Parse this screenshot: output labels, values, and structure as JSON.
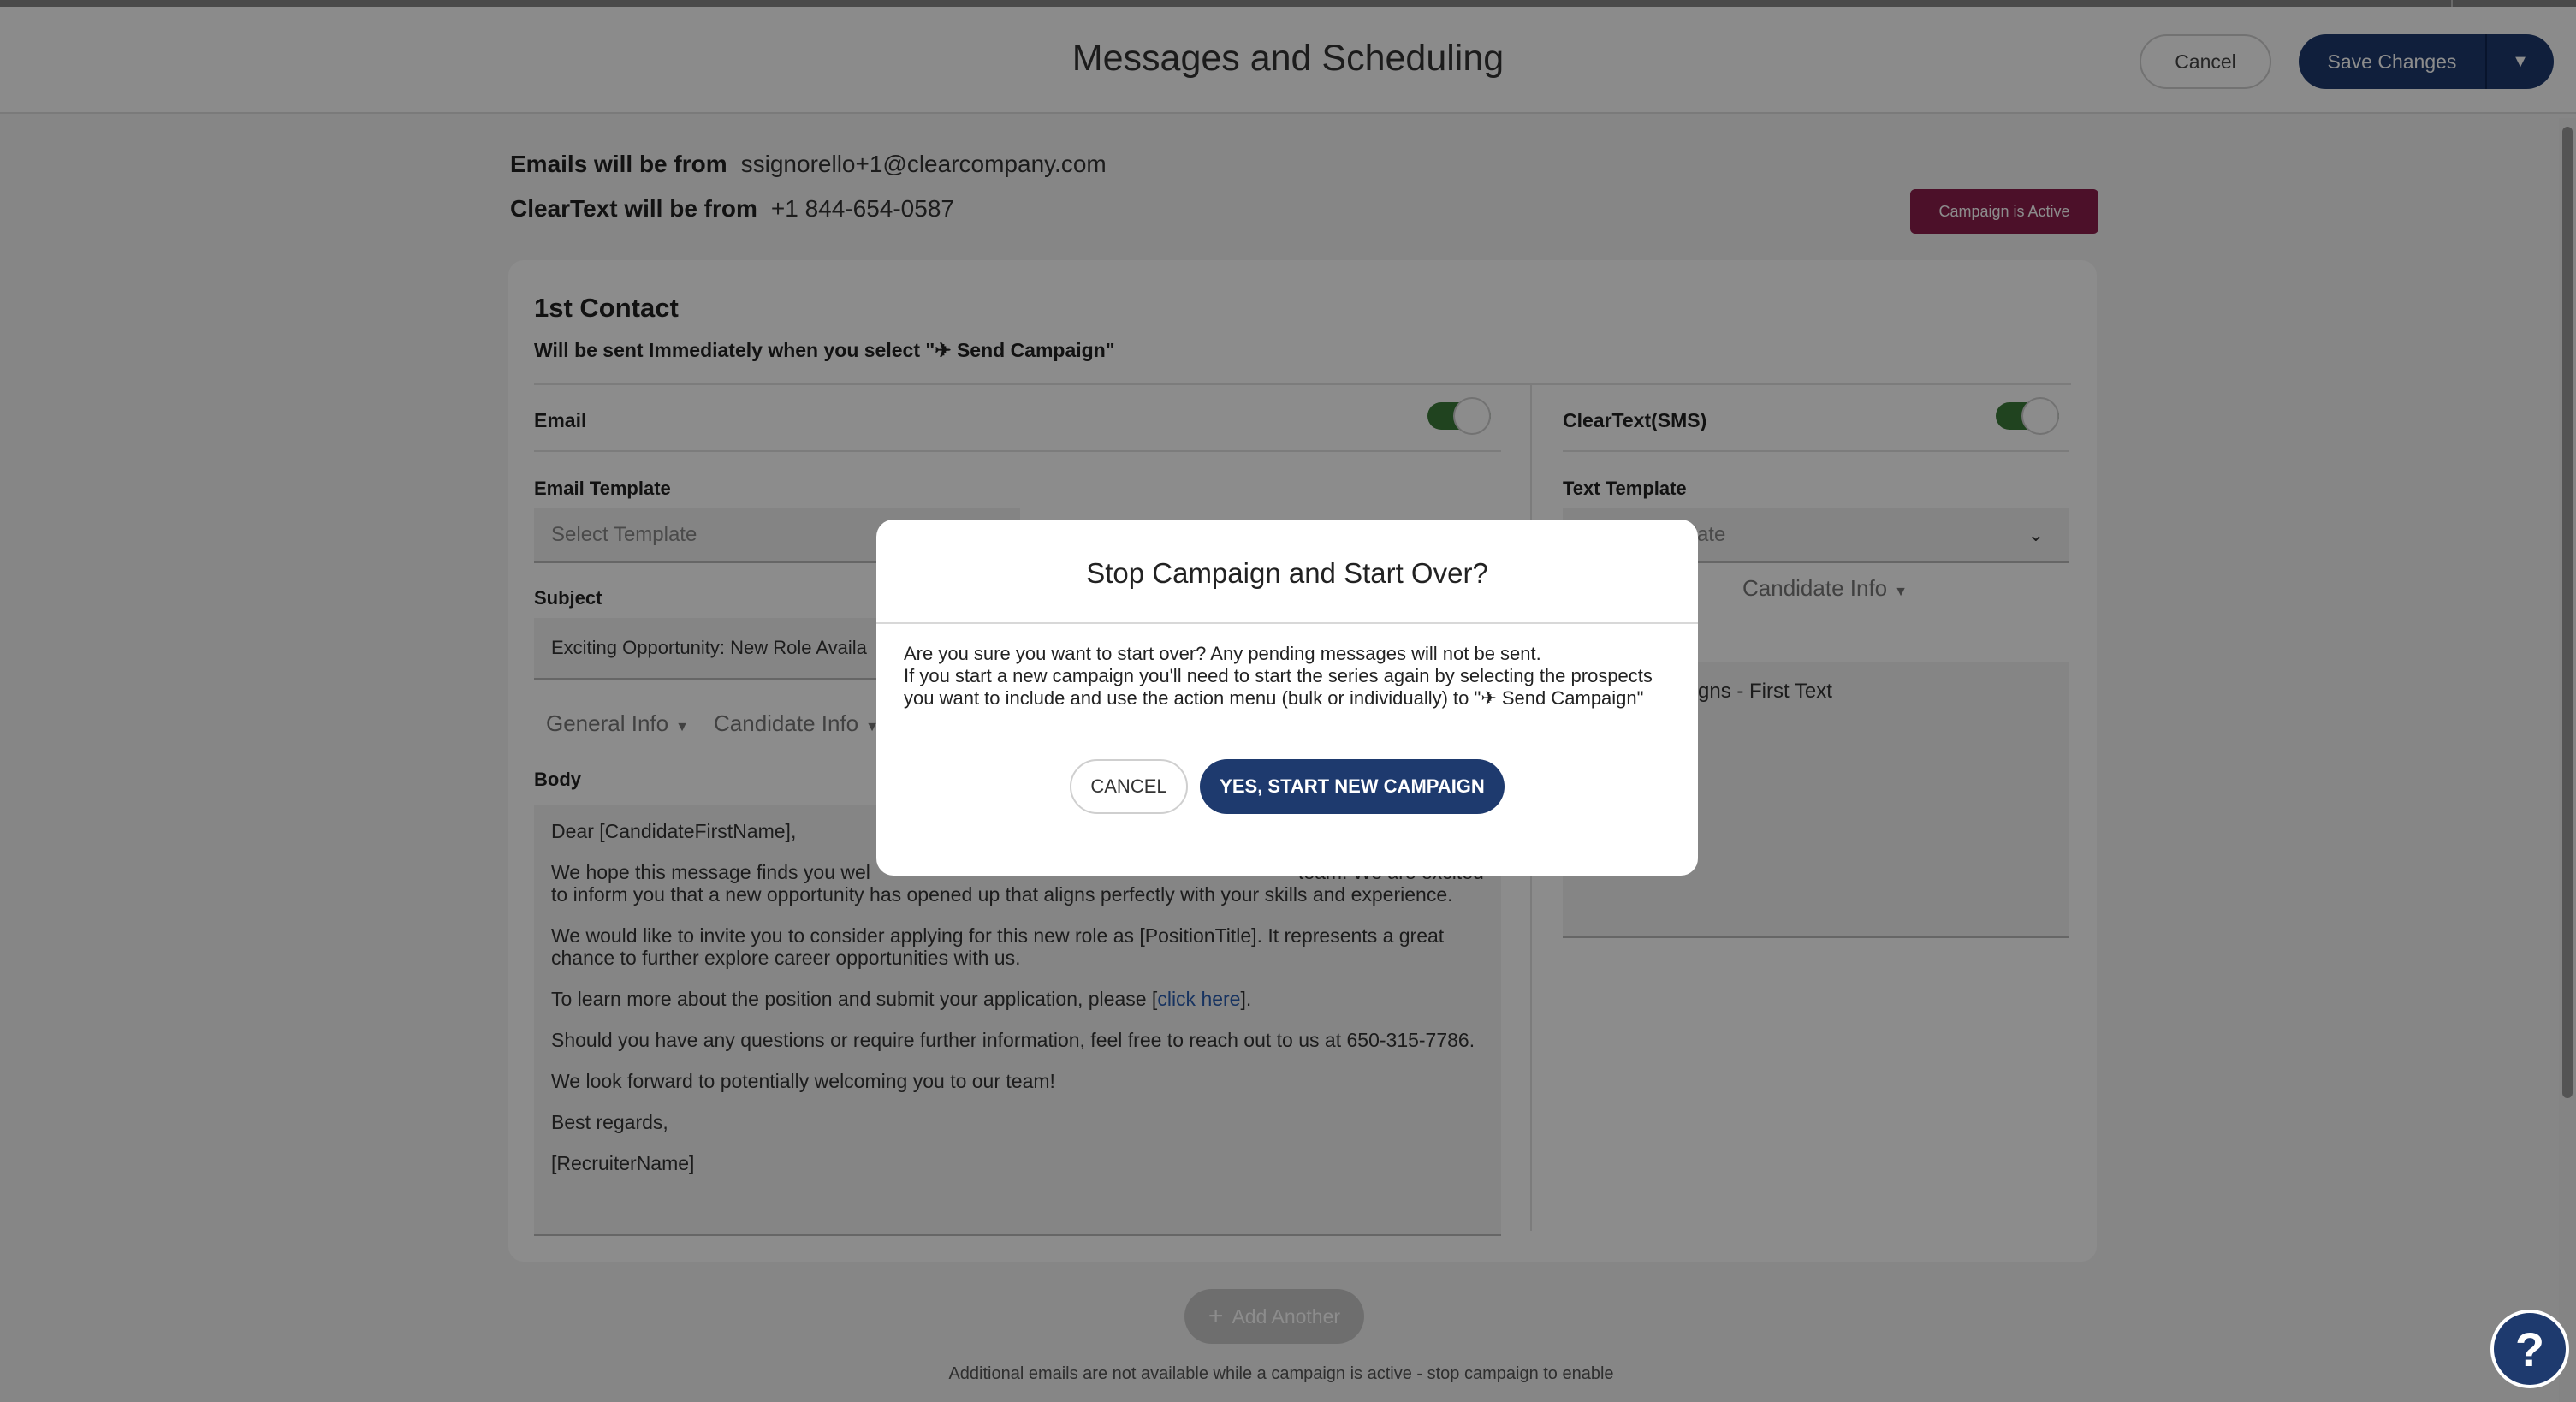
{
  "header": {
    "title": "Messages and Scheduling",
    "cancel_label": "Cancel",
    "save_label": "Save Changes"
  },
  "from": {
    "email_label": "Emails will be from",
    "email_value": "ssignorello+1@clearcompany.com",
    "text_label": "ClearText will be from",
    "text_value": "+1 844-654-0587"
  },
  "campaign_status": "Campaign is Active",
  "contact": {
    "title": "1st Contact",
    "schedule_prefix": "Will be sent Immediately when you select \"",
    "schedule_action": "Send Campaign",
    "schedule_suffix": "\"",
    "email": {
      "label": "Email",
      "enabled": true,
      "template_label": "Email Template",
      "template_placeholder": "Select Template",
      "subject_label": "Subject",
      "subject_value": "Exciting Opportunity: New Role Availa",
      "menu_general": "General Info",
      "menu_candidate": "Candidate Info",
      "body_label": "Body",
      "body": {
        "p1": "Dear [CandidateFirstName],",
        "p2": "We hope this message finds you wel",
        "p2b": "team. We are excited to inform you that a new opportunity has opened up that aligns perfectly with your skills and experience.",
        "p3": "We would like to invite you to consider applying for this new role as [PositionTitle]. It represents a great chance to further explore career opportunities with us.",
        "p4_prefix": "To learn more about the position and submit your application, please [",
        "p4_link": "click here",
        "p4_suffix": "].",
        "p5": "Should you have any questions or require further information, feel free to reach out to us at 650-315-7786.",
        "p6": "We look forward to potentially welcoming you to our team!",
        "p7": "Best regards,",
        "p8": "[RecruiterName]"
      }
    },
    "sms": {
      "label": "ClearText(SMS)",
      "enabled": true,
      "template_label": "Text Template",
      "template_placeholder": "Select Template",
      "menu_candidate": "Candidate Info",
      "text_value": "gns - First Text"
    }
  },
  "add_another_label": "Add Another",
  "footer_note": "Additional emails are not available while a campaign is active - stop campaign to enable",
  "modal": {
    "title": "Stop Campaign and Start Over?",
    "line1": "Are you sure you want to start over? Any pending messages will not be sent.",
    "line2_prefix": "If you start a new campaign you'll need to start the series again by selecting the prospects you want to include and use the action menu (bulk or individually) to \"",
    "line2_action": "Send Campaign",
    "line2_suffix": "\"",
    "cancel_label": "CANCEL",
    "confirm_label": "YES, START NEW CAMPAIGN"
  },
  "help_label": "?",
  "icons": {
    "send": "paper-plane-icon",
    "caret": "caret-down-icon",
    "chevron": "chevron-down-icon",
    "plus": "plus-icon",
    "help": "question-mark-icon"
  },
  "colors": {
    "primary": "#1e3a6e",
    "active_badge": "#8b1e4b",
    "toggle_on": "#3b7a3a",
    "link": "#2a5db0"
  }
}
